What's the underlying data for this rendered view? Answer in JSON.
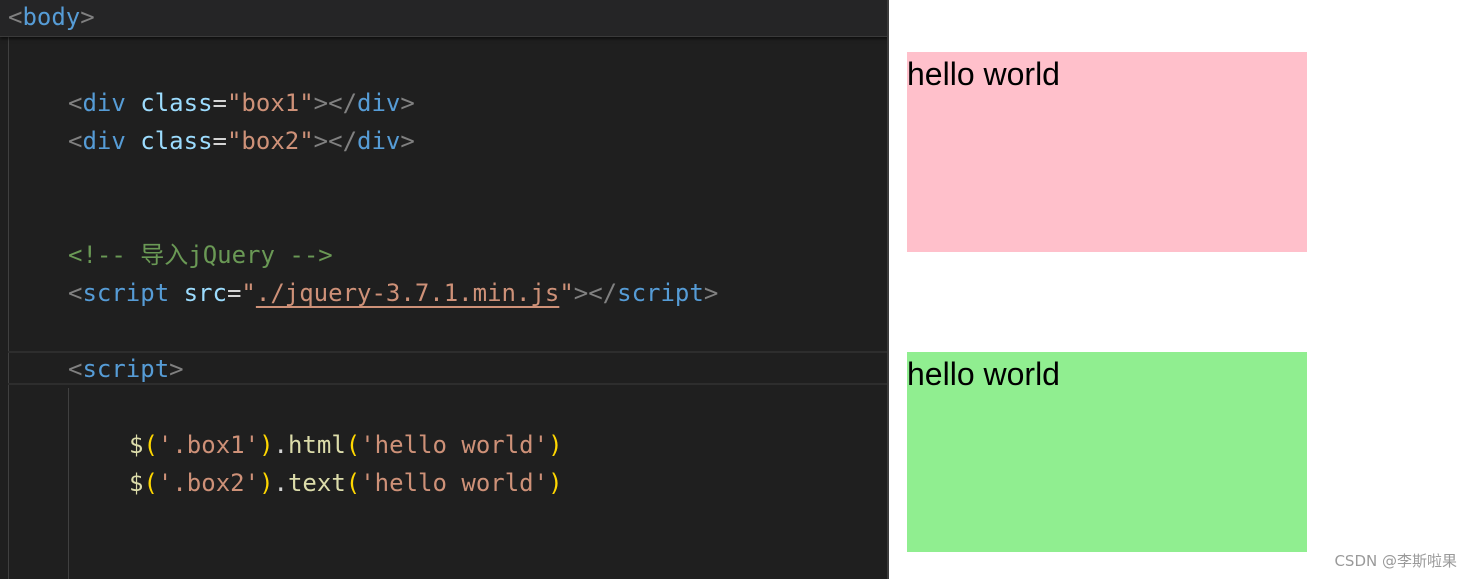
{
  "editor": {
    "sticky_header": {
      "lt": "<",
      "tag": "body",
      "gt": ">"
    },
    "lines": {
      "div1": {
        "lt": "<",
        "tag": "div",
        "attr": "class",
        "eq": "=",
        "value": "\"box1\"",
        "close": "></",
        "close_tag": "div",
        "gt": ">"
      },
      "div2": {
        "lt": "<",
        "tag": "div",
        "attr": "class",
        "eq": "=",
        "value": "\"box2\"",
        "close": "></",
        "close_tag": "div",
        "gt": ">"
      },
      "comment": "<!-- 导入jQuery -->",
      "script_src": {
        "lt": "<",
        "tag": "script",
        "attr": "src",
        "eq": "=",
        "quote_open": "\"",
        "value": "./jquery-3.7.1.min.js",
        "quote_close": "\"",
        "close": "></",
        "close_tag": "script",
        "gt": ">"
      },
      "script_open": {
        "lt": "<",
        "tag": "script",
        "gt": ">"
      },
      "call1": {
        "fn": "$",
        "p1": "(",
        "arg": "'.box1'",
        "p2": ")",
        "dot": ".",
        "method": "html",
        "p3": "(",
        "value": "'hello world'",
        "p4": ")"
      },
      "call2": {
        "fn": "$",
        "p1": "(",
        "arg": "'.box2'",
        "p2": ")",
        "dot": ".",
        "method": "text",
        "p3": "(",
        "value": "'hello world'",
        "p4": ")"
      }
    }
  },
  "preview": {
    "box1_text": "hello world",
    "box2_text": "hello world",
    "box1_color": "#ffc0cb",
    "box2_color": "#90ee90"
  },
  "watermark": "CSDN @李斯啦果",
  "colors": {
    "editor_bg": "#1f1f1f",
    "tag": "#569cd6",
    "attribute": "#9cdcfe",
    "string": "#ce9178",
    "comment": "#6a9955",
    "function": "#dcdcaa",
    "bracket": "#ffd700",
    "punctuation": "#808080"
  }
}
